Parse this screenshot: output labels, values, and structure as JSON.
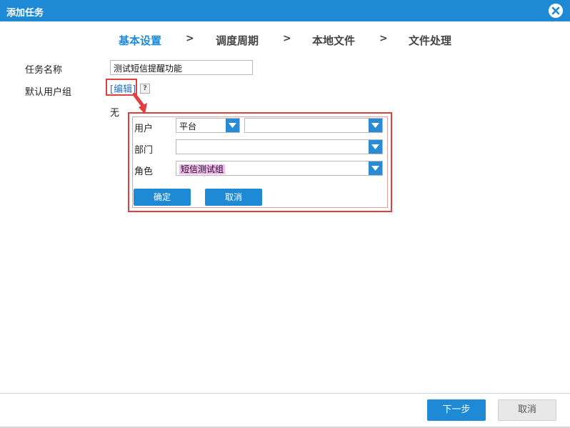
{
  "dialog": {
    "title": "添加任务"
  },
  "steps": {
    "items": [
      "基本设置",
      "调度周期",
      "本地文件",
      "文件处理"
    ],
    "separator": ">"
  },
  "form": {
    "task_name_label": "任务名称",
    "task_name_value": "测试短信提醒功能",
    "default_group_label": "默认用户组",
    "edit_link": "[编辑]",
    "help_icon": "?",
    "none_text": "无"
  },
  "popup": {
    "user_label": "用户",
    "user_type_value": "平台",
    "user_value": "",
    "dept_label": "部门",
    "dept_value": "",
    "role_label": "角色",
    "role_value": "短信测试组",
    "ok_label": "确定",
    "cancel_label": "取消"
  },
  "footer": {
    "next_label": "下一步",
    "cancel_label": "取消"
  },
  "colors": {
    "accent": "#1e8ad6",
    "highlight_box": "#e04040",
    "role_highlight": "#f4b8f0"
  }
}
